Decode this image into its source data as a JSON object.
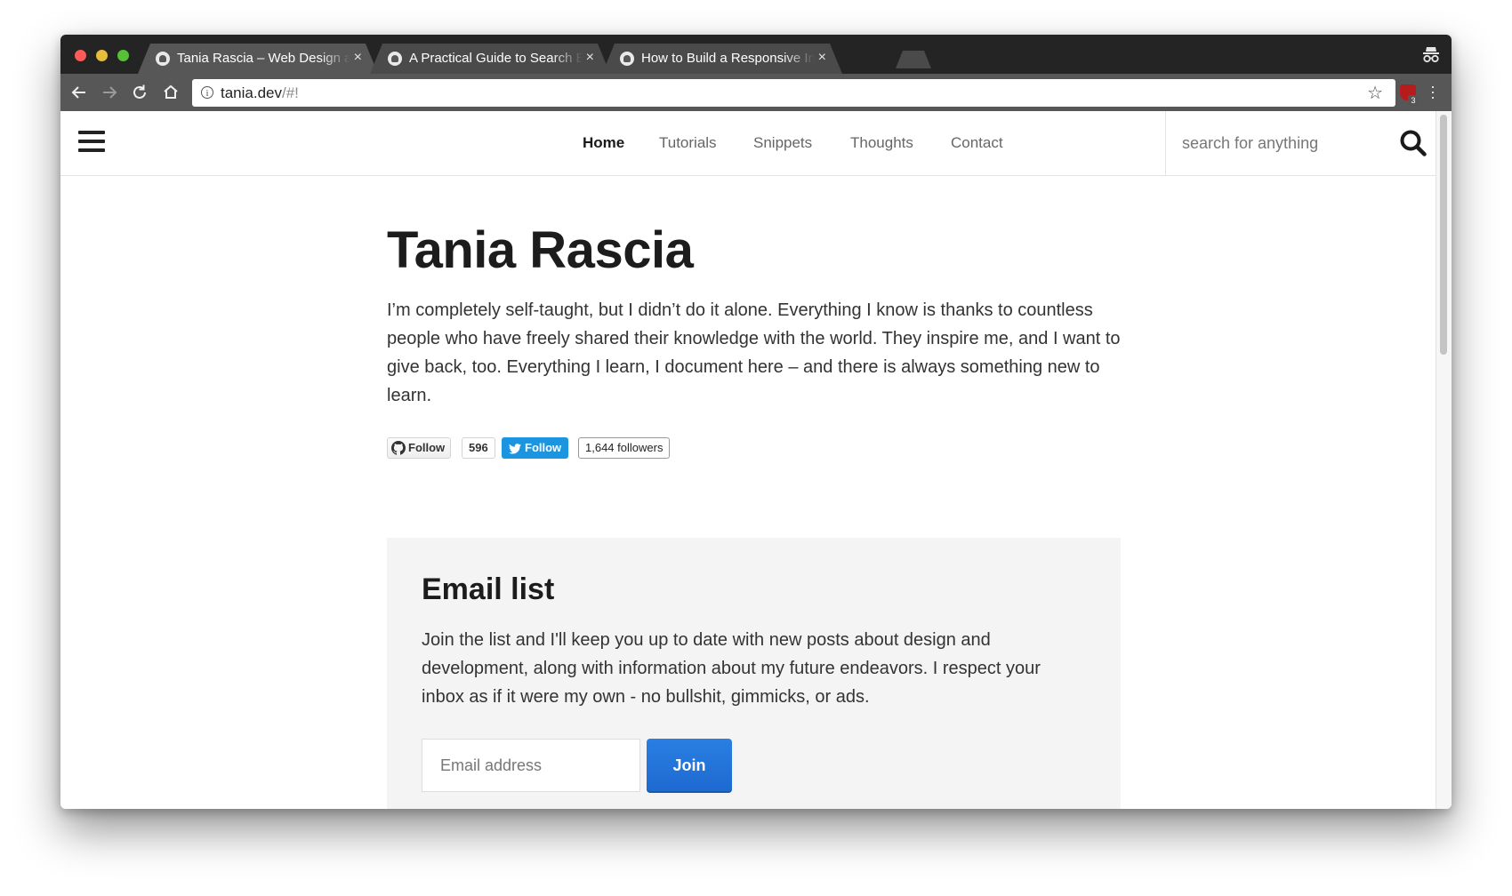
{
  "browser": {
    "tabs": [
      {
        "title": "Tania Rascia – Web Design and Development",
        "active": true
      },
      {
        "title": "A Practical Guide to Search Engine Optimization",
        "active": false
      },
      {
        "title": "How to Build a Responsive Image Gallery",
        "active": false
      }
    ],
    "tab_close": "×",
    "url_host": "tania.dev",
    "url_path": "/#!",
    "extension_badge": "3",
    "colors": {
      "tabstrip": "#242424",
      "toolbar": "#575757"
    }
  },
  "site": {
    "nav": [
      {
        "label": "Home",
        "active": true
      },
      {
        "label": "Tutorials",
        "active": false
      },
      {
        "label": "Snippets",
        "active": false
      },
      {
        "label": "Thoughts",
        "active": false
      },
      {
        "label": "Contact",
        "active": false
      }
    ],
    "search_placeholder": "search for anything",
    "title": "Tania Rascia",
    "intro": "I’m completely self-taught, but I didn’t do it alone. Everything I know is thanks to countless people who have freely shared their knowledge with the world. They inspire me, and I want to give back, too. Everything I learn, I document here – and there is always something new to learn.",
    "social": {
      "github_follow": "Follow",
      "github_count": "596",
      "twitter_follow": "Follow",
      "twitter_count": "1,644 followers"
    },
    "email": {
      "title": "Email list",
      "description": "Join the list and I'll keep you up to date with new posts about design and development, along with information about my future endeavors. I respect your inbox as if it were my own - no bullshit, gimmicks, or ads.",
      "placeholder": "Email address",
      "button": "Join",
      "button_color": "#1d6fd8"
    }
  }
}
